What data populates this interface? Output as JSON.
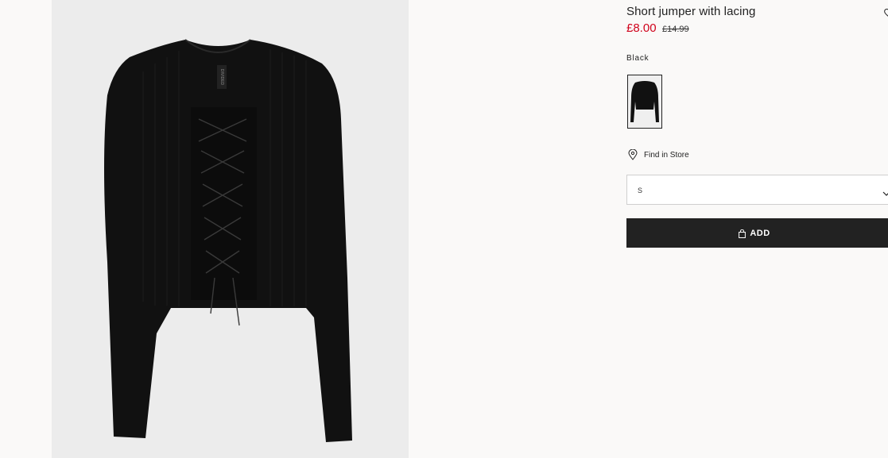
{
  "product": {
    "title": "Short jumper with lacing",
    "price_sale": "£8.00",
    "price_original": "£14.99",
    "color_name": "Black",
    "brand_tag": "DIVIDED"
  },
  "swatches": [
    {
      "color": "Black",
      "selected": true
    }
  ],
  "store": {
    "find_label": "Find in Store"
  },
  "size_select": {
    "selected": "S"
  },
  "actions": {
    "add_label": "ADD"
  },
  "colors": {
    "sale_price": "#d0021b",
    "button_bg": "#222222",
    "page_bg": "#faf9f8",
    "image_bg": "#ececec"
  },
  "icons": [
    "heart-icon",
    "location-pin-icon",
    "chevron-down-icon",
    "shopping-bag-icon"
  ]
}
